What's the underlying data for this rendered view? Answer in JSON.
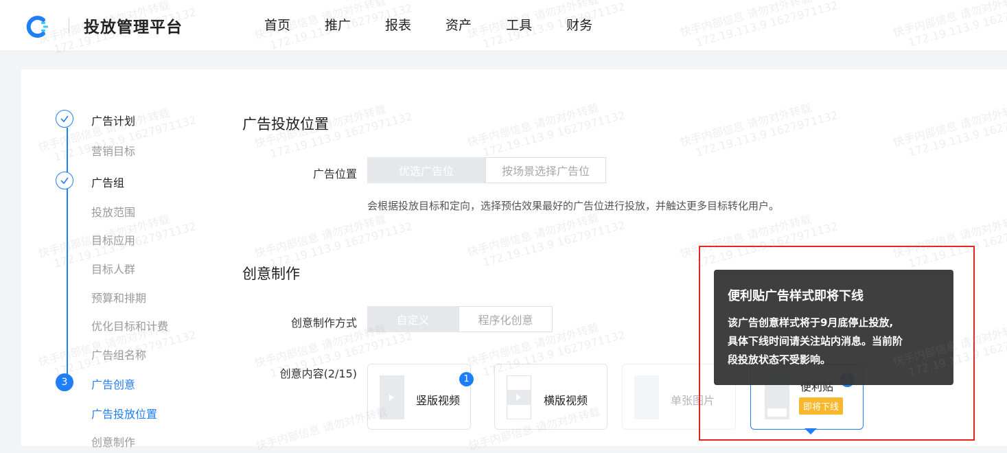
{
  "app": {
    "title": "投放管理平台"
  },
  "nav": [
    "首页",
    "推广",
    "报表",
    "资产",
    "工具",
    "财务"
  ],
  "steps": {
    "step1": {
      "title": "广告计划",
      "subs": [
        "营销目标"
      ]
    },
    "step2": {
      "title": "广告组",
      "subs": [
        "投放范围",
        "目标应用",
        "目标人群",
        "预算和排期",
        "优化目标和计费",
        "广告组名称"
      ]
    },
    "step3": {
      "number": "3",
      "title": "广告创意",
      "subs": [
        "广告投放位置",
        "创意制作"
      ]
    }
  },
  "placement": {
    "section_title": "广告投放位置",
    "label": "广告位置",
    "options": [
      "优选广告位",
      "按场景选择广告位"
    ],
    "hint": "会根据投放目标和定向，选择预估效果最好的广告位进行投放，并触达更多目标转化用户。"
  },
  "creative": {
    "section_title": "创意制作",
    "method_label": "创意制作方式",
    "method_options": [
      "自定义",
      "程序化创意"
    ],
    "content_label": "创意内容(2/15)",
    "cards": {
      "vertical": {
        "label": "竖版视频",
        "count": "1"
      },
      "horizontal": {
        "label": "横版视频"
      },
      "image": {
        "label": "单张图片"
      },
      "sticky": {
        "label": "便利贴",
        "count": "1",
        "tag": "即将下线"
      }
    }
  },
  "tooltip": {
    "title": "便利贴广告样式即将下线",
    "lines": [
      "该广告创意样式将于9月底停止投放,",
      "具体下线时间请关注站内消息。当前阶",
      "段投放状态不受影响。"
    ]
  },
  "watermark": {
    "line1": "快手内部信息 请勿对外转载",
    "line2": "172.19.113.9 1627971132"
  },
  "colors": {
    "accent": "#1f7ef9",
    "warning": "#f7b82e",
    "highlight": "#e8231d"
  }
}
